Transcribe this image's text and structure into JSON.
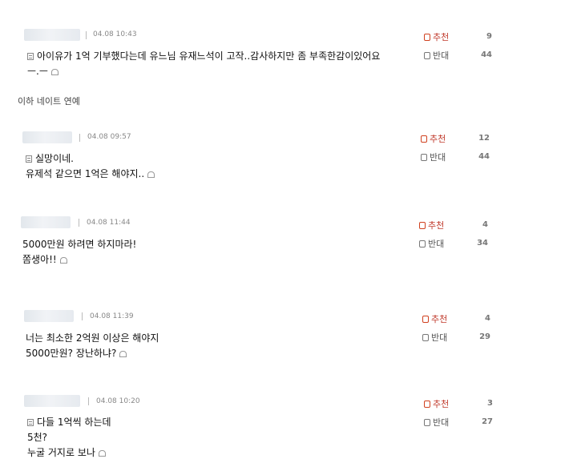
{
  "vote_labels": {
    "up": "추천",
    "down": "반대"
  },
  "section_label": "이하 네이트 연예",
  "comments": [
    {
      "time": "04.08 10:43",
      "lines": [
        "아이유가 1억 기부했다는데 유느님 유재느석이 고작..감사하지만 좀 부족한감이있어요",
        "ㅡ.ㅡ"
      ],
      "up": "9",
      "down": "44"
    },
    {
      "time": "04.08 09:57",
      "lines": [
        "실망이네.",
        "유제석 같으면 1억은 해야지.."
      ],
      "up": "12",
      "down": "44"
    },
    {
      "time": "04.08 11:44",
      "lines": [
        "5000만원 하려면 하지마라!",
        "쫌생아!!"
      ],
      "up": "4",
      "down": "34"
    },
    {
      "time": "04.08 11:39",
      "lines": [
        "너는 최소한 2억원 이상은 해야지",
        "5000만원? 장난하냐?"
      ],
      "up": "4",
      "down": "29"
    },
    {
      "time": "04.08 10:20",
      "lines": [
        "다들 1억씩 하는데",
        "5천?",
        "누굴 거지로 보나"
      ],
      "up": "3",
      "down": "27"
    }
  ]
}
